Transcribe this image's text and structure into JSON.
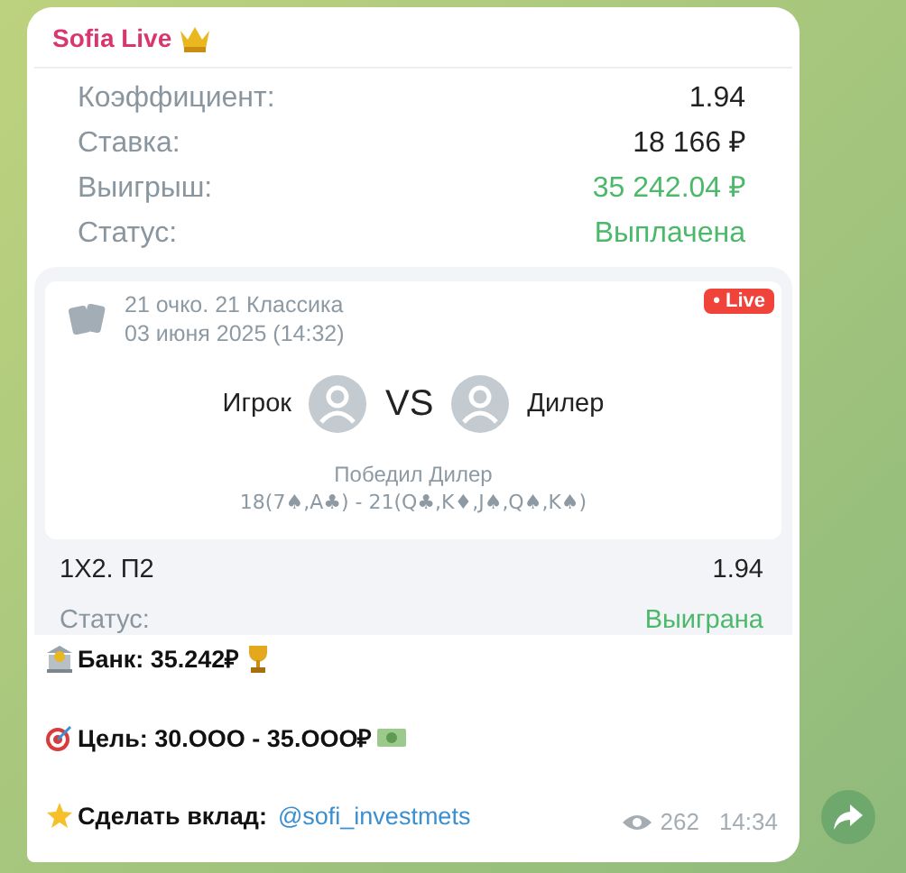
{
  "message": {
    "sender": "Sofia Live",
    "stats": [
      {
        "label": "Коэффициент:",
        "value": "1.94",
        "kind": "normal"
      },
      {
        "label": "Ставка:",
        "value": "18 166 ₽",
        "kind": "normal"
      },
      {
        "label": "Выигрыш:",
        "value": "35 242.04 ₽",
        "kind": "positive"
      },
      {
        "label": "Статус:",
        "value": "Выплачена",
        "kind": "positive"
      }
    ],
    "game": {
      "badge": "• Live",
      "title": "21 очко. 21 Классика",
      "date": "03 июня 2025 (14:32)",
      "player": "Игрок",
      "versus": "VS",
      "dealer": "Дилер",
      "result": "Победил Дилер",
      "hands": "18(7♠,A♣) - 21(Q♣,K♦,J♠,Q♠,K♠)"
    },
    "bet": {
      "market": "1X2. П2",
      "odds": "1.94",
      "status_label": "Статус:",
      "status": "Выиграна"
    },
    "lines": [
      {
        "text": "Банк: 35.242₽"
      },
      {
        "text": "Цель: 30.OOO - 35.OOO₽"
      },
      {
        "text": "Сделать вклад:",
        "link": "@sofi_investmets"
      }
    ],
    "views": "262",
    "time": "14:34"
  }
}
